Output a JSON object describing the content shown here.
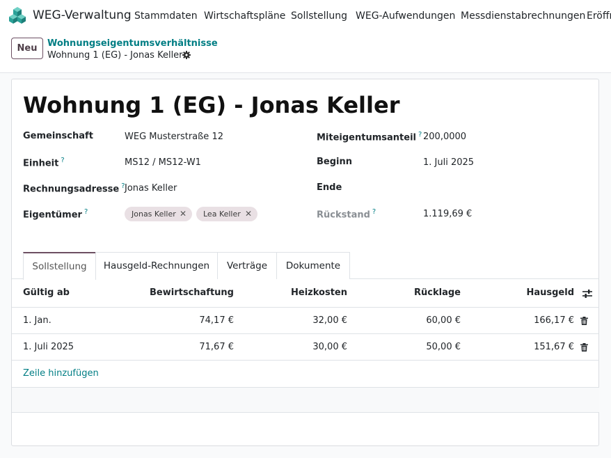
{
  "navbar": {
    "app_name": "WEG-Verwaltung",
    "menu": [
      "Stammdaten",
      "Wirtschaftspläne",
      "Sollstellung",
      "WEG-Aufwendungen",
      "Messdienstabrechnungen",
      "Eröffn"
    ]
  },
  "control_panel": {
    "new_button": "Neu",
    "breadcrumb_parent": "Wohnungseigentumsverhältnisse",
    "breadcrumb_current": "Wohnung 1 (EG) - Jonas Keller"
  },
  "record": {
    "title": "Wohnung 1 (EG) - Jonas Keller",
    "left_fields": [
      {
        "label": "Gemeinschaft",
        "value": "WEG Musterstraße 12",
        "help": false
      },
      {
        "label": "Einheit",
        "value": "MS12 / MS12-W1",
        "help": true
      },
      {
        "label": "Rechnungsadresse",
        "value": "Jonas Keller",
        "help": true
      },
      {
        "label": "Eigentümer",
        "value": "",
        "help": true
      }
    ],
    "owners": [
      "Jonas Keller",
      "Lea Keller"
    ],
    "right_fields": [
      {
        "label": "Miteigentumsanteil",
        "value": "200,0000",
        "help": true
      },
      {
        "label": "Beginn",
        "value": "1. Juli 2025",
        "help": false
      },
      {
        "label": "Ende",
        "value": "",
        "help": false
      },
      {
        "label": "Rückstand",
        "value": "1.119,69 €",
        "help": true
      }
    ]
  },
  "tabs": [
    "Sollstellung",
    "Hausgeld-Rechnungen",
    "Verträge",
    "Dokumente"
  ],
  "active_tab": "Sollstellung",
  "table": {
    "columns": [
      "Gültig ab",
      "Bewirtschaftung",
      "Heizkosten",
      "Rücklage",
      "Hausgeld"
    ],
    "rows": [
      [
        "1. Jan.",
        "74,17 €",
        "32,00 €",
        "60,00 €",
        "166,17 €"
      ],
      [
        "1. Juli 2025",
        "71,67 €",
        "30,00 €",
        "50,00 €",
        "151,67 €"
      ]
    ],
    "add_line": "Zeile hinzufügen"
  },
  "colors": {
    "primary": "#6c4f62",
    "link": "#017e84"
  }
}
